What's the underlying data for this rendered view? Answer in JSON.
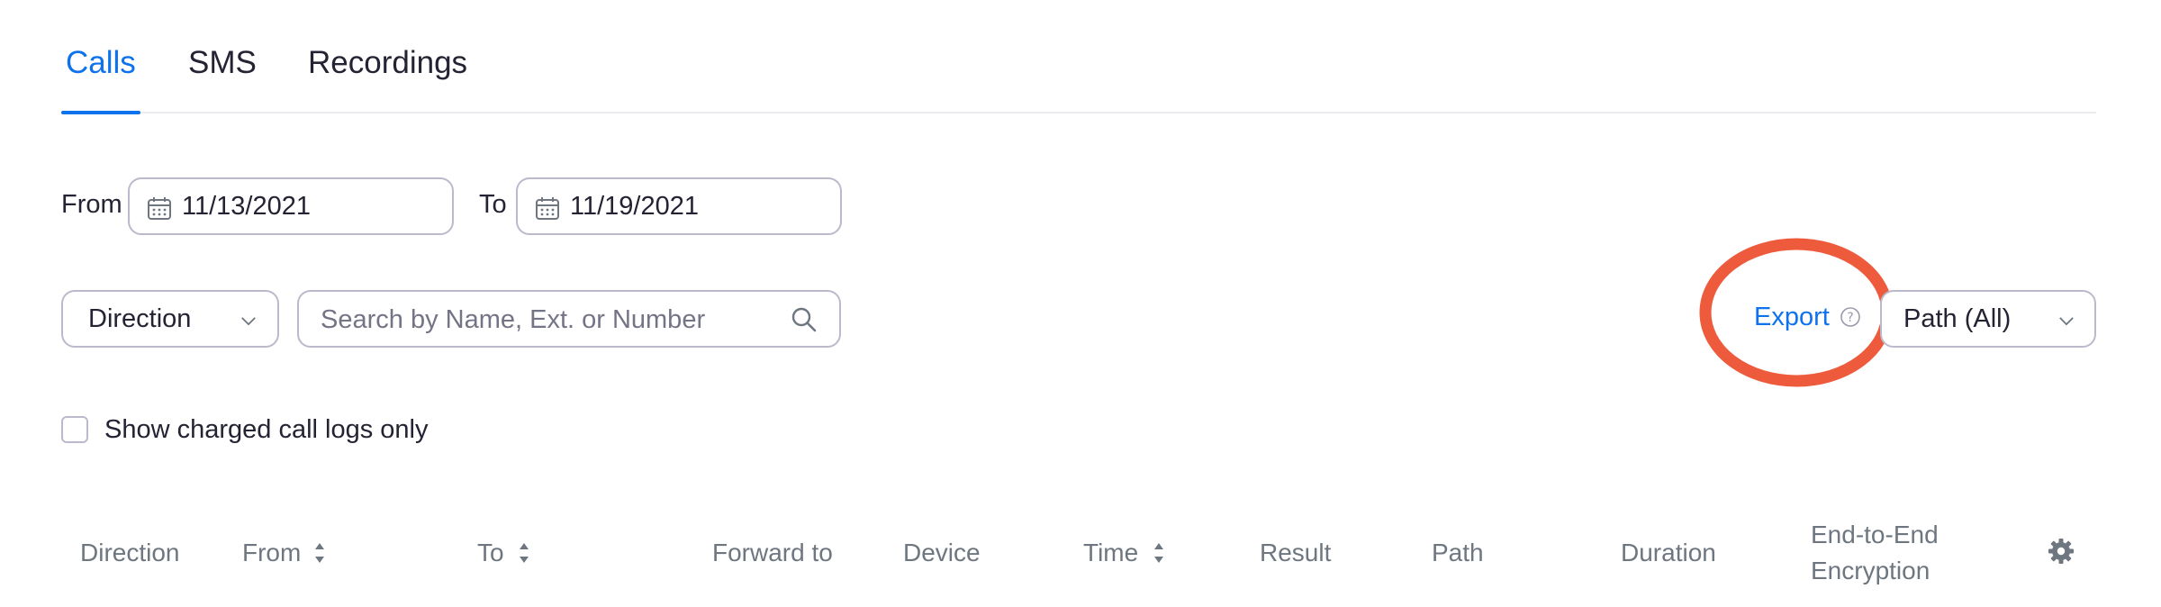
{
  "tabs": [
    {
      "label": "Calls",
      "active": true
    },
    {
      "label": "SMS",
      "active": false
    },
    {
      "label": "Recordings",
      "active": false
    }
  ],
  "date_range": {
    "from_label": "From",
    "from_value": "11/13/2021",
    "to_label": "To",
    "to_value": "11/19/2021"
  },
  "filters": {
    "direction_select": "Direction",
    "search_placeholder": "Search by Name, Ext. or Number",
    "export_label": "Export",
    "path_select": "Path (All)"
  },
  "checkbox": {
    "label": "Show charged call logs only",
    "checked": false
  },
  "table": {
    "columns": [
      {
        "label": "Direction",
        "sortable": false
      },
      {
        "label": "From",
        "sortable": true
      },
      {
        "label": "To",
        "sortable": true
      },
      {
        "label": "Forward to",
        "sortable": false
      },
      {
        "label": "Device",
        "sortable": false
      },
      {
        "label": "Time",
        "sortable": true
      },
      {
        "label": "Result",
        "sortable": false
      },
      {
        "label": "Path",
        "sortable": false
      },
      {
        "label": "Duration",
        "sortable": false
      },
      {
        "label": "End-to-End",
        "sortable": false
      },
      {
        "label": "Encryption",
        "sortable": false
      }
    ]
  },
  "colors": {
    "accent": "#0e72ed",
    "annotation_circle": "#ee5a3c",
    "border": "#babacc"
  },
  "icons": [
    "calendar-icon",
    "chevron-down-icon",
    "search-icon",
    "help-circle-icon",
    "sort-icon",
    "gear-icon"
  ]
}
